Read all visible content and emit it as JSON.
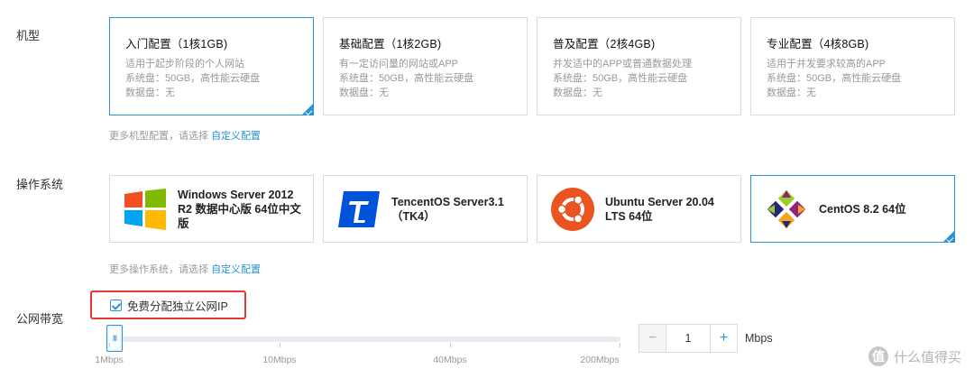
{
  "machine_type": {
    "label": "机型",
    "cards": [
      {
        "title": "入门配置（1核1GB)",
        "lines": [
          "适用于起步阶段的个人网站",
          "系统盘：50GB，高性能云硬盘",
          "数据盘：无"
        ],
        "selected": true
      },
      {
        "title": "基础配置（1核2GB)",
        "lines": [
          "有一定访问量的网站或APP",
          "系统盘：50GB，高性能云硬盘",
          "数据盘：无"
        ],
        "selected": false
      },
      {
        "title": "普及配置（2核4GB)",
        "lines": [
          "并发适中的APP或普通数据处理",
          "系统盘：50GB，高性能云硬盘",
          "数据盘：无"
        ],
        "selected": false
      },
      {
        "title": "专业配置（4核8GB)",
        "lines": [
          "适用于并发要求较高的APP",
          "系统盘：50GB，高性能云硬盘",
          "数据盘：无"
        ],
        "selected": false
      }
    ],
    "more_text": "更多机型配置，请选择",
    "more_link": "自定义配置"
  },
  "os": {
    "label": "操作系统",
    "cards": [
      {
        "name_lines": [
          "Windows Server 2012",
          "R2 数据中心版 64位中文",
          "版"
        ],
        "icon": "windows-icon",
        "selected": false
      },
      {
        "name_lines": [
          "TencentOS Server3.1",
          "（TK4）"
        ],
        "icon": "tencentos-icon",
        "selected": false
      },
      {
        "name_lines": [
          "Ubuntu Server 20.04",
          "LTS 64位"
        ],
        "icon": "ubuntu-icon",
        "selected": false
      },
      {
        "name_lines": [
          "CentOS 8.2 64位"
        ],
        "icon": "centos-icon",
        "selected": true
      }
    ],
    "more_text": "更多操作系统，请选择",
    "more_link": "自定义配置"
  },
  "bandwidth": {
    "label": "公网带宽",
    "checkbox_label": "免费分配独立公网IP",
    "checked": true,
    "handle_glyph": "III",
    "ticks": [
      "1Mbps",
      "10Mbps",
      "40Mbps",
      "200Mbps"
    ],
    "value": "1",
    "minus": "−",
    "plus": "+",
    "unit": "Mbps"
  },
  "watermark": {
    "glyph": "值",
    "text": "什么值得买"
  },
  "colors": {
    "accent": "#2a93d5",
    "highlight": "#e53935"
  }
}
